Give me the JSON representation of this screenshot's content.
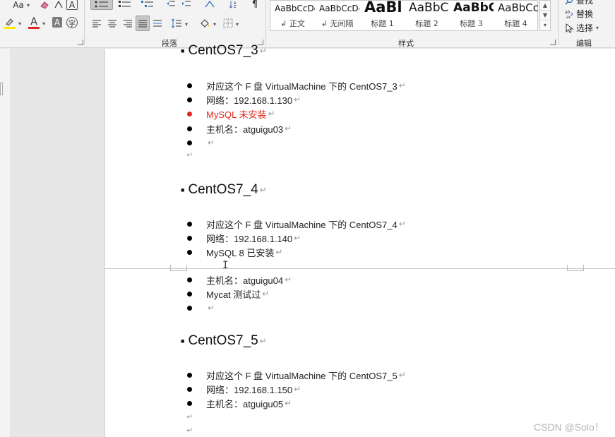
{
  "ribbon": {
    "font_group": {
      "aa_label": "Aa",
      "letter_a": "A"
    },
    "paragraph_group": {
      "label": "段落"
    },
    "styles_group": {
      "label": "样式",
      "items": [
        {
          "sample": "AaBbCcDc",
          "name": "↲ 正文"
        },
        {
          "sample": "AaBbCcDc",
          "name": "↲ 无间隔"
        },
        {
          "sample": "AaBl",
          "name": "标题 1"
        },
        {
          "sample": "AaBbC",
          "name": "标题 2"
        },
        {
          "sample": "AaBbC",
          "name": "标题 3"
        },
        {
          "sample": "AaBbCc",
          "name": "标题 4"
        }
      ]
    },
    "editing_group": {
      "label": "编辑",
      "find": "查找",
      "replace": "替换",
      "select": "选择"
    }
  },
  "document": {
    "sections": [
      {
        "heading": "CentOS7_3",
        "bullets": [
          {
            "text": "对应这个 F 盘 VirtualMachine 下的 CentOS7_3",
            "color": "#222222"
          },
          {
            "text": "网络：192.168.1.130",
            "color": "#222222"
          },
          {
            "text": "MySQL  未安装",
            "color": "#e0281e"
          },
          {
            "text": "主机名：atguigu03",
            "color": "#222222"
          },
          {
            "text": "",
            "color": "#222222"
          }
        ]
      },
      {
        "heading": "CentOS7_4",
        "bullets": [
          {
            "text": "对应这个 F 盘 VirtualMachine 下的 CentOS7_4"
          },
          {
            "text": "网络：192.168.1.140"
          },
          {
            "text": "MySQL 8 已安装"
          },
          {
            "text": "主机名：atguigu04"
          },
          {
            "text": "Mycat  测试过"
          },
          {
            "text": ""
          }
        ]
      },
      {
        "heading": "CentOS7_5",
        "bullets": [
          {
            "text": "对应这个 F 盘 VirtualMachine 下的 CentOS7_5"
          },
          {
            "text": "网络：192.168.1.150"
          },
          {
            "text": "主机名：atguigu05"
          }
        ]
      }
    ],
    "paragraph_mark": "↵"
  },
  "watermark": "CSDN @Solo！"
}
